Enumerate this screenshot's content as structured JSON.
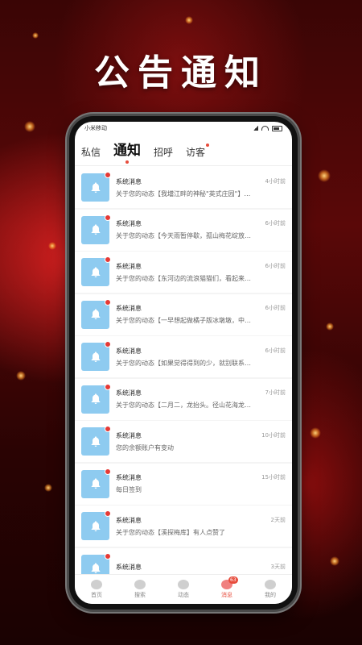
{
  "headline": "公告通知",
  "status": {
    "carrier": "小米移动"
  },
  "tabs": [
    {
      "label": "私信",
      "dot": false
    },
    {
      "label": "通知",
      "active": true
    },
    {
      "label": "招呼",
      "dot": false
    },
    {
      "label": "访客",
      "dot": true
    }
  ],
  "messages": [
    {
      "title": "系统消息",
      "time": "4小时前",
      "content": "关于您的动态【我壋江畔的神秘\"英式庄园\"】…"
    },
    {
      "title": "系统消息",
      "time": "6小时前",
      "content": "关于您的动态【今天雨暂停歇，孤山梅花绽放…"
    },
    {
      "title": "系统消息",
      "time": "6小时前",
      "content": "关于您的动态【东河边的流浪猫猫们，看起来…"
    },
    {
      "title": "系统消息",
      "time": "6小时前",
      "content": "关于您的动态【一早想起做橘子版冰墩墩，中…"
    },
    {
      "title": "系统消息",
      "time": "6小时前",
      "content": "关于您的动态【如果觉得得到的少，就别联系…"
    },
    {
      "title": "系统消息",
      "time": "7小时前",
      "content": "关于您的动态【二月二，龙抬头。径山花海龙…"
    },
    {
      "title": "系统消息",
      "time": "10小时前",
      "content": "您的余额账户有变动"
    },
    {
      "title": "系统消息",
      "time": "15小时前",
      "content": "每日签到"
    },
    {
      "title": "系统消息",
      "time": "2天前",
      "content": "关于您的动态【溪探梅库】有人点赞了"
    },
    {
      "title": "系统消息",
      "time": "3天前",
      "content": ""
    }
  ],
  "bottom_nav": [
    {
      "label": "首页"
    },
    {
      "label": "搜索"
    },
    {
      "label": "动态"
    },
    {
      "label": "消息",
      "badge": "63",
      "active": true
    },
    {
      "label": "我的"
    }
  ],
  "colors": {
    "accent": "#e74c3c",
    "avatar_bg": "#8ecbf0"
  }
}
